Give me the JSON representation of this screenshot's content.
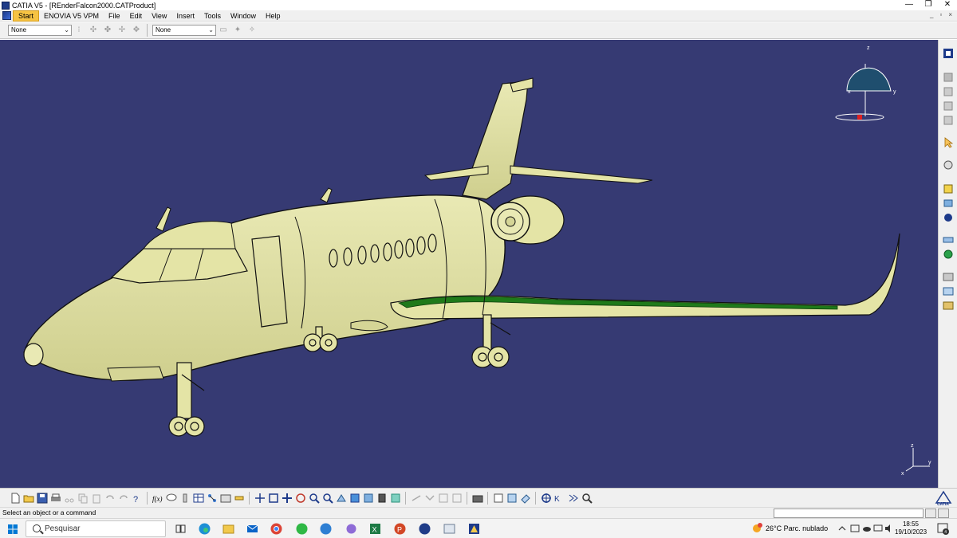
{
  "window": {
    "title": "CATIA V5 - [REnderFalcon2000.CATProduct]",
    "minimize": "—",
    "maximize": "❐",
    "close": "✕",
    "mdi_minimize": "_",
    "mdi_restore": "▫",
    "mdi_close": "×"
  },
  "menubar": {
    "items": [
      "Start",
      "ENOVIA V5 VPM",
      "File",
      "Edit",
      "View",
      "Insert",
      "Tools",
      "Window",
      "Help"
    ]
  },
  "toolbar": {
    "combo1_value": "None",
    "combo2_value": "None"
  },
  "viewport": {
    "background": "#363a73",
    "compass_labels": {
      "z": "z",
      "y": "y",
      "x": "x"
    },
    "axis_labels": {
      "z": "z",
      "y": "y",
      "x": "x"
    }
  },
  "statusbar": {
    "message": "Select an object or a command"
  },
  "taskbar": {
    "search_label": "Pesquisar",
    "weather": "26°C  Parc. nublado",
    "time": "18:55",
    "date": "19/10/2023",
    "notification_count": "4"
  },
  "colors": {
    "viewport_bg": "#363a73",
    "fuselage": "#e4e4a6",
    "wing_green": "#1f7a1a",
    "active_menu": "#f6c343",
    "compass_fill": "#1f4e6e"
  },
  "icons": {
    "bottom_toolbar": [
      "new-icon",
      "open-icon",
      "save-icon",
      "print-icon",
      "cut-icon",
      "copy-icon",
      "paste-icon",
      "undo-icon",
      "redo-icon",
      "whats-this-icon",
      "formula-icon",
      "comment-icon",
      "macro-icon",
      "table-icon",
      "tree-icon",
      "capture-icon",
      "measure-icon",
      "fly-mode-icon",
      "fit-all-icon",
      "pan-icon",
      "rotate-icon",
      "zoom-in-icon",
      "zoom-out-icon",
      "normal-view-icon",
      "iso-view-icon",
      "shading-icon",
      "hide-show-icon",
      "swap-icon",
      "sketch-icon",
      "constraint-icon",
      "snap-icon",
      "render-icon",
      "save-management-icon",
      "catalog-icon",
      "eraser-icon",
      "compass-icon",
      "analysis-icon",
      "search-icon"
    ]
  }
}
